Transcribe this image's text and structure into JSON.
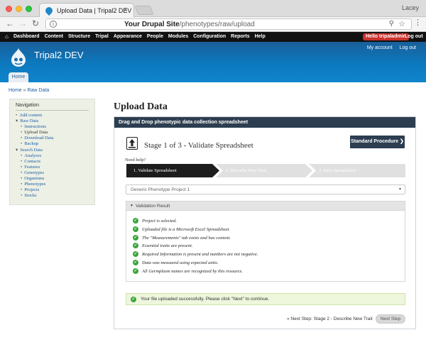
{
  "browser": {
    "tab_title": "Upload Data | Tripal2 DEV",
    "tab_close": "×",
    "profile_name": "Lacey",
    "url_host": "Your Drupal Site",
    "url_path": "/phenotypes/raw/upload"
  },
  "admin_bar": {
    "home_icon": "home-icon",
    "items": [
      "Dashboard",
      "Content",
      "Structure",
      "Tripal",
      "Appearance",
      "People",
      "Modules",
      "Configuration",
      "Reports",
      "Help"
    ],
    "hello": "Hello tripaladmin",
    "logout": "Log out"
  },
  "header": {
    "site_name": "Tripal2 DEV",
    "my_account": "My account",
    "log_out": "Log out",
    "home_tab": "Home",
    "bg_color": "#0c79be"
  },
  "breadcrumb": {
    "home": "Home",
    "sep": " » ",
    "current": "Raw Data"
  },
  "sidebar": {
    "title": "Navigation",
    "items": [
      {
        "label": "Add content",
        "level": 0
      },
      {
        "label": "Raw Data",
        "level": 0
      },
      {
        "label": "Instructions",
        "level": 1
      },
      {
        "label": "Upload Data",
        "level": 1
      },
      {
        "label": "Download Data",
        "level": 1
      },
      {
        "label": "Backup",
        "level": 1
      },
      {
        "label": "Search Data",
        "level": 0
      },
      {
        "label": "Analyses",
        "level": 1
      },
      {
        "label": "Contacts",
        "level": 1
      },
      {
        "label": "Features",
        "level": 1
      },
      {
        "label": "Genotypes",
        "level": 1
      },
      {
        "label": "Organisms",
        "level": 1
      },
      {
        "label": "Phenotypes",
        "level": 1
      },
      {
        "label": "Projects",
        "level": 1
      },
      {
        "label": "Stocks",
        "level": 1
      }
    ]
  },
  "main": {
    "page_title": "Upload Data",
    "panel_title": "Drag and Drop phenotypic data collection spreadsheet",
    "stage_title": "Stage 1 of 3 - Validate Spreadsheet",
    "standard_procedure": "Standard Procedure ❯",
    "need_help": "Need help?",
    "steps": [
      "1. Validate Spreadsheet",
      "2. Describe New Trait",
      "3. Save Spreadsheet"
    ],
    "project_select": "Generic Phenotype Project 1",
    "validation_toggle": "▼",
    "validation_title": "Validation Result",
    "checks": [
      "Project is selected.",
      "Uploaded file is a Microsoft Excel Spreadsheet.",
      "The \"Measurements\" tab exists and has content.",
      "Essential traits are present.",
      "Required Information is present and numbers are not negative.",
      "Data was measured using expected units.",
      "All Germplasm names are recognized by this resource."
    ],
    "success_message": "Your file uploaded successfully. Please click \"Next\" to continue.",
    "next_step_link": "» Next Step: Stage 2 - Describe New Trait",
    "next_button": "Next Step",
    "accent_dark": "#2c3e50",
    "success_green": "#3aa63d"
  }
}
